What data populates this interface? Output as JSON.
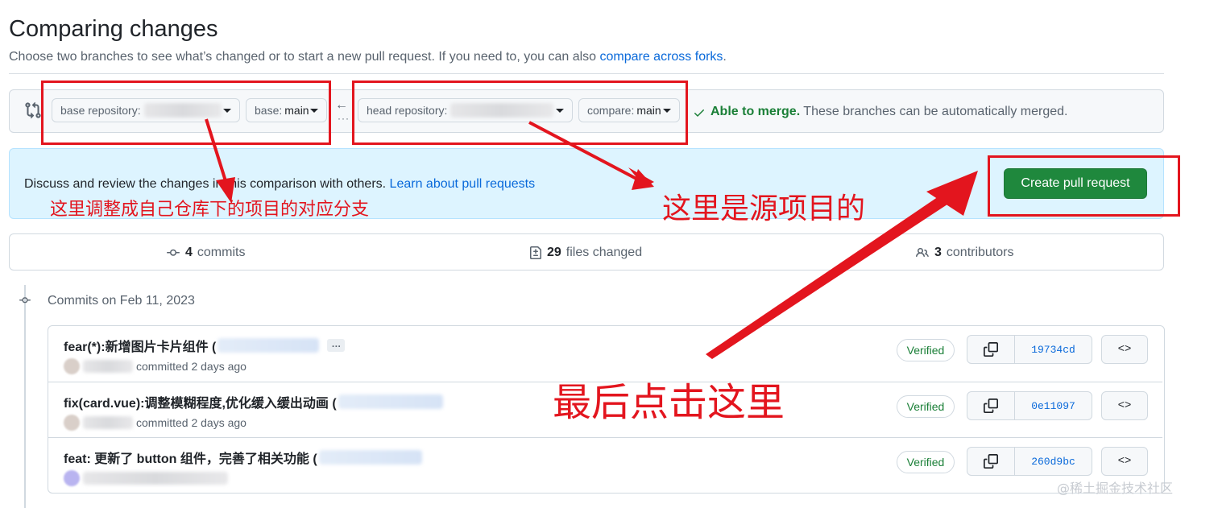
{
  "header": {
    "title": "Comparing changes",
    "subtitle": "Choose two branches to see what’s changed or to start a new pull request. If you need to, you can also ",
    "subtitle_link": "compare across forks",
    "subtitle_end": "."
  },
  "range": {
    "base_repo_label": "base repository:",
    "base_branch_label": "base:",
    "base_branch_value": "main",
    "head_repo_label": "head repository:",
    "compare_label": "compare:",
    "compare_value": "main",
    "arrow": "←",
    "dots": "···",
    "merge_status_bold": "Able to merge.",
    "merge_status_rest": " These branches can be automatically merged."
  },
  "discuss": {
    "text": "Discuss and review the changes in this comparison with others. ",
    "link": "Learn about pull requests",
    "create_button": "Create pull request"
  },
  "stats": {
    "commits_count": "4",
    "commits_label": "commits",
    "files_count": "29",
    "files_label": "files changed",
    "contributors_count": "3",
    "contributors_label": "contributors"
  },
  "timeline": {
    "date_heading": "Commits on Feb 11, 2023"
  },
  "commits": [
    {
      "message": "fear(*):新增图片卡片组件 (",
      "meta": "committed 2 days ago",
      "verified": "Verified",
      "sha": "19734cd",
      "browse": "<>"
    },
    {
      "message": "fix(card.vue):调整模糊程度,优化缓入缓出动画 (",
      "meta": "committed 2 days ago",
      "verified": "Verified",
      "sha": "0e11097",
      "browse": "<>"
    },
    {
      "message": "feat: 更新了 button 组件，完善了相关功能 (",
      "meta": "",
      "verified": "Verified",
      "sha": "260d9bc",
      "browse": "<>"
    }
  ],
  "commit_ellipsis": "…",
  "annotations": {
    "base_note": "这里调整成自己仓库下的项目的对应分支",
    "head_note": "这里是源项目的",
    "final_note": "最后点击这里",
    "color": "#e3151e"
  },
  "watermark": "@稀土掘金技术社区",
  "colors": {
    "primary_button": "#1f883d",
    "link": "#0969da",
    "success": "#1a7f37",
    "flash_bg": "#ddf4ff"
  }
}
